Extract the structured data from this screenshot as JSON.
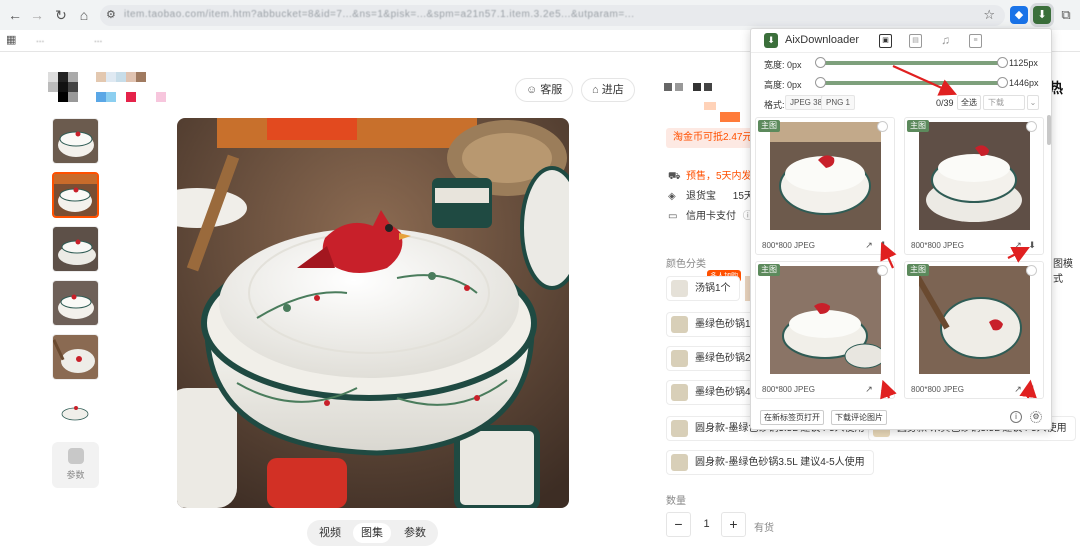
{
  "browser": {
    "url": "item.taobao.com/item.htm?abbucket=8&id=7...&ns=1&pisk=...&spm=a21n57.1.item.3.2e5...&utparam=...",
    "bookmarks": [
      "...",
      "..."
    ]
  },
  "page": {
    "customer_service": "客服",
    "enter_shop": "进店",
    "title_tail": "热",
    "coin_text": "淘金币可抵2.47元",
    "presale": "预售，5天内发",
    "return": "退货宝",
    "return_days": "15天退",
    "credit": "信用卡支付",
    "color_label": "颜色分类",
    "view_mode": "图模式",
    "param_label": "参数",
    "tabs": [
      "视频",
      "图集",
      "参数"
    ],
    "hot_badge": "多人加购",
    "skus": [
      "汤锅1个",
      "墨绿色砂锅1.",
      "墨绿色砂锅2.",
      "墨绿色砂锅4",
      "圆身款-墨绿色砂锅3.5L 建议4-5人使用",
      "圆身款-米黄色砂锅3.5L 建议4-5人使用",
      "圆身款-墨绿色砂锅3.5L 建议4-5人使用"
    ],
    "qty_label": "数量",
    "qty_minus": "−",
    "qty_value": "1",
    "qty_plus": "+",
    "stock": "有货"
  },
  "popup": {
    "app_name": "AixDownloader",
    "width_label": "宽度: 0px",
    "width_max": "1125px",
    "height_label": "高度: 0px",
    "height_max": "1446px",
    "format_label": "格式:",
    "formats": [
      "JPEG 38",
      "PNG 1"
    ],
    "count": "0/39",
    "select_all": "全选",
    "download_select": "下载",
    "cards": [
      {
        "tag": "主图",
        "meta": "800*800  JPEG"
      },
      {
        "tag": "主图",
        "meta": "800*800  JPEG"
      },
      {
        "tag": "主图",
        "meta": "800*800  JPEG"
      },
      {
        "tag": "主图",
        "meta": "800*800  JPEG"
      }
    ],
    "open_in_tab": "在新标签页打开",
    "download_reviews": "下载评论图片"
  },
  "colors": {
    "accent": "#ff5000",
    "popup_green": "#5c8a5c",
    "arrow": "#e02020"
  }
}
